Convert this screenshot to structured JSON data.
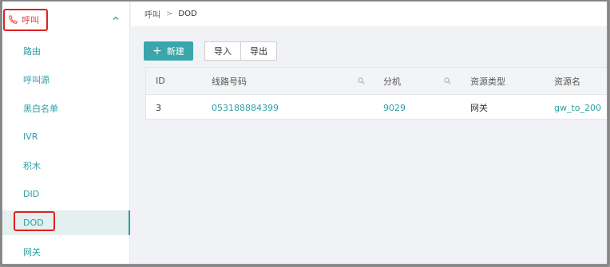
{
  "sidebar": {
    "section_title": "呼叫",
    "items": [
      {
        "label": "路由"
      },
      {
        "label": "呼叫源"
      },
      {
        "label": "黑白名单"
      },
      {
        "label": "IVR"
      },
      {
        "label": "积木"
      },
      {
        "label": "DID"
      },
      {
        "label": "DOD"
      },
      {
        "label": "网关"
      }
    ]
  },
  "breadcrumb": {
    "parent": "呼叫",
    "separator": ">",
    "current": "DOD"
  },
  "toolbar": {
    "new_label": "新建",
    "import_label": "导入",
    "export_label": "导出"
  },
  "table": {
    "columns": [
      "ID",
      "线路号码",
      "分机",
      "资源类型",
      "资源名"
    ],
    "rows": [
      {
        "id": "3",
        "number": "053188884399",
        "extension": "9029",
        "type": "网关",
        "name": "gw_to_200"
      }
    ]
  },
  "colors": {
    "accent": "#3aa6ac",
    "highlight": "#e02020"
  }
}
